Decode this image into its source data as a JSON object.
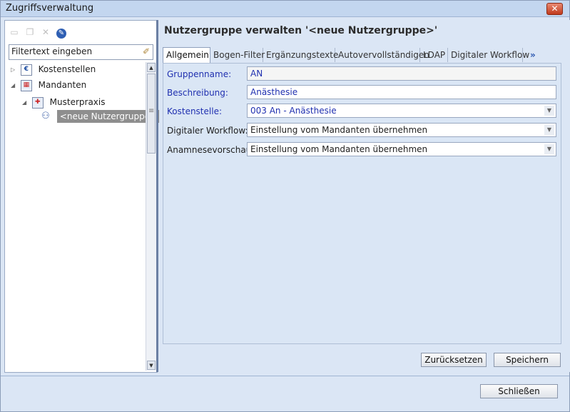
{
  "window": {
    "title": "Zugriffsverwaltung",
    "close_label": "✕"
  },
  "left": {
    "filter_placeholder": "Filtertext eingeben",
    "tree": [
      {
        "label": "Kostenstellen"
      },
      {
        "label": "Mandanten"
      },
      {
        "label": "Musterpraxis"
      },
      {
        "label": "<neue Nutzergruppe>"
      }
    ]
  },
  "right": {
    "heading": "Nutzergruppe verwalten '<neue Nutzergruppe>'",
    "tabs": [
      "Allgemein",
      "Bogen-Filter",
      "Ergänzungstexte",
      "Autovervollständigen",
      "LDAP",
      "Digitaler Workflow"
    ],
    "tabs_more": "»",
    "fields": {
      "gruppenname": {
        "label": "Gruppenname:",
        "value": "AN"
      },
      "beschreibung": {
        "label": "Beschreibung:",
        "value": "Anästhesie"
      },
      "kostenstelle": {
        "label": "Kostenstelle:",
        "value": "003 An - Anästhesie"
      },
      "workflow": {
        "label": "Digitaler Workflow:",
        "value": "Einstellung vom Mandanten übernehmen"
      },
      "anamnese": {
        "label": "Anamnesevorschau",
        "value": "Einstellung vom Mandanten übernehmen"
      }
    },
    "reset_label": "Zurücksetzen",
    "save_label": "Speichern"
  },
  "footer": {
    "close_label": "Schließen"
  },
  "colors": {
    "accent": "#2030b0",
    "title_bar": "#c3d6ef",
    "selection": "#8e8e8e"
  }
}
